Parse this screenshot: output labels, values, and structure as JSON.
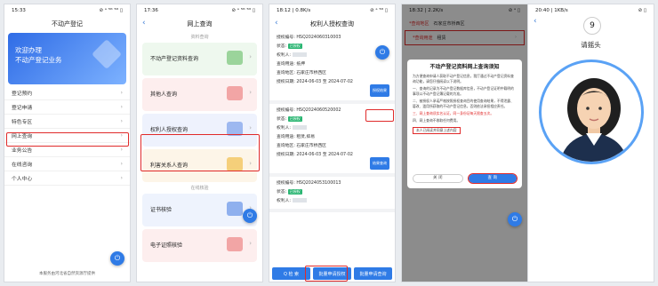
{
  "p1": {
    "time": "15:33",
    "status": "⊘ ᵃ ⁵ᴳ ⁵ᴳ ▯",
    "title": "不动产登记",
    "banner_line1": "欢迎办理",
    "banner_line2": "不动产登记业务",
    "menu": [
      "登记预约",
      "登记申请",
      "特色专区",
      "网上查询",
      "业务公告",
      "在线咨询",
      "个人中心"
    ],
    "footer": "本服务由河北省自然资源厅提供"
  },
  "p2": {
    "time": "17:36",
    "status": "⊘ ᵃ ⁵ᴳ ⁵ᴳ ▯",
    "title": "网上查询",
    "section1": "资料查询",
    "section2": "在线核验",
    "cards": [
      "不动产登记资料查询",
      "其他人查询",
      "权利人授权查询",
      "利害关系人查询",
      "证书核验",
      "电子证照核验"
    ]
  },
  "p3": {
    "time": "18:12 | 0.8K/s",
    "status": "⊘ ᵃ ⁵ᴳ ▯",
    "title": "权利人授权查询",
    "records": [
      {
        "auth_no": "授权编号: HSQ2024060310003",
        "status_label": "状态:",
        "status": "已授权",
        "holder": "权利人:",
        "purpose_label": "查询用途:",
        "purpose": "抵押",
        "area_label": "查询地区:",
        "area": "石家庄市桥西区",
        "date_label": "授权日期:",
        "date": "2024-06-03 至 2024-07-02",
        "btn": "授权结果"
      },
      {
        "auth_no": "授权编号: HSQ2024060520002",
        "status_label": "状态:",
        "status": "已授权",
        "holder": "权利人:",
        "purpose_label": "查询用途:",
        "purpose": "租赁,抑易",
        "area_label": "查询地区:",
        "area": "石家庄市桥西区",
        "date_label": "授权日期:",
        "date": "2024-06-03 至 2024-07-02",
        "btn": "结果查询"
      },
      {
        "auth_no": "授权编号: HSQ2024053100013",
        "status_label": "状态:",
        "status": "已授权",
        "holder": "权利人:",
        "purpose_label": "",
        "purpose": "",
        "area_label": "",
        "area": "",
        "date_label": "",
        "date": "",
        "btn": ""
      }
    ],
    "bottom": [
      "Q 检 索",
      "批量申请授权",
      "批量申请查询"
    ]
  },
  "p4": {
    "time": "18:32 | 2.2K/s",
    "status": "⊘ ᵃ ▯",
    "area_label": "*查询地区",
    "area": "石家庄市桥西区",
    "purpose_label": "*查询用途",
    "purpose": "租赁",
    "modal_title": "不动产登记资料网上查询须知",
    "para1": "为方便查询申请人获取不动产登记信息，我厅通过不动产登记资料查询功能，请您仔细阅读以下说明。",
    "para2": "一、查询的记录为不动产登记数据库信息，不动产登记证明中载明的事项以不动产登记簿记载的为准。",
    "para3": "二、被授权人承诺严格按照授权查询目的使用查询结果，不得泄露、篡改、滥用所获取的不动产登记信息，否则依法承担相应责任。",
    "para4": "三、网上查询须实名认证，同一身份证每天限查五次。",
    "para5": "四、网上查询不收取任何费用。",
    "confirm": "本人已阅读并同意上述内容",
    "btn_cancel": "关 闭",
    "btn_ok": "查 询"
  },
  "p5": {
    "time": "20:40 | 1KB/s",
    "status": "⊘ ▯",
    "countdown": "9",
    "instruction": "请摇头"
  }
}
